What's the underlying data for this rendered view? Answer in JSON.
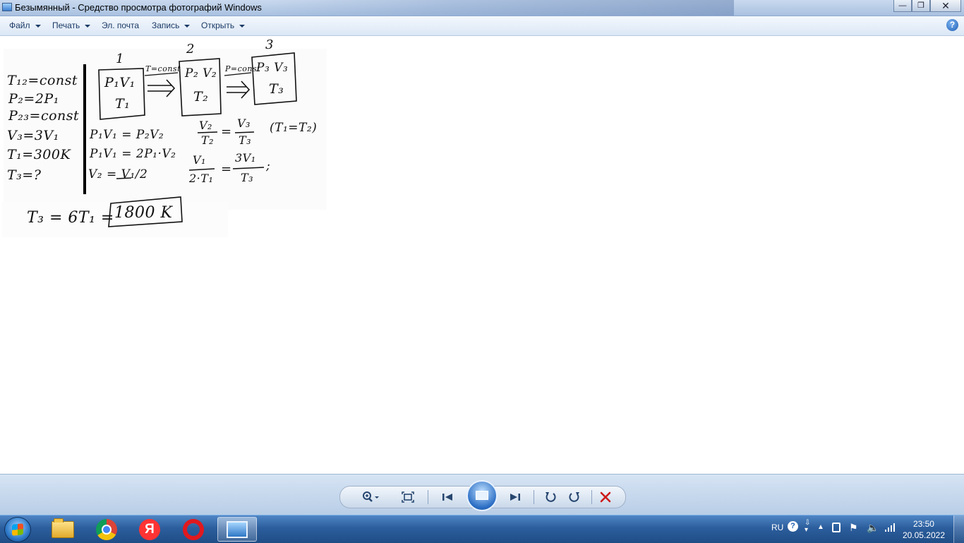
{
  "window": {
    "title": "Безымянный - Средство просмотра фотографий Windows",
    "buttons": [
      "minimize-button",
      "maximize-button",
      "close-button"
    ]
  },
  "menu": {
    "items": [
      {
        "label": "Файл",
        "has_dropdown": true
      },
      {
        "label": "Печать",
        "has_dropdown": true
      },
      {
        "label": "Эл. почта",
        "has_dropdown": false
      },
      {
        "label": "Запись",
        "has_dropdown": true
      },
      {
        "label": "Открыть",
        "has_dropdown": true
      }
    ],
    "help": "?"
  },
  "photo": {
    "given": [
      "T₁₂=const",
      "P₂=2P₁",
      "P₂₃=const",
      "V₃=3V₁",
      "T₁=300K",
      "T₃=?"
    ],
    "state_labels": [
      "1",
      "2",
      "3"
    ],
    "states": [
      {
        "top": "P₁V₁",
        "bottom": "T₁"
      },
      {
        "top": "P₂ V₂",
        "bottom": "T₂"
      },
      {
        "top": "P₃ V₃",
        "bottom": "T₃"
      }
    ],
    "transitions": [
      "T=const",
      "P=const"
    ],
    "equations_left": [
      "P₁V₁ = P₂V₂",
      "P₁V₁ = 2P₁·V₂",
      "V₂ = V₁/2"
    ],
    "eq_right_1": {
      "num_a": "V₂",
      "den_a": "T₂",
      "num_b": "V₃",
      "den_b": "T₃",
      "note": "(T₁=T₂)"
    },
    "eq_right_2": {
      "num_a": "V₁",
      "den_a": "2·T₁",
      "num_b": "3V₁",
      "den_b": "T₃",
      "tail": ";"
    },
    "result_prefix": "T₃ = 6T₁ =",
    "result_value": "1800 K"
  },
  "controls": {
    "icons": [
      "zoom-icon",
      "fit-icon",
      "previous-icon",
      "slideshow-icon",
      "next-icon",
      "rotate-left-icon",
      "rotate-right-icon",
      "delete-icon"
    ]
  },
  "taskbar": {
    "apps": [
      "explorer",
      "chrome",
      "yandex-browser",
      "opera",
      "photo-viewer"
    ],
    "yandex_letter": "Я",
    "language": "RU",
    "time": "23:50",
    "date": "20.05.2022"
  },
  "colors": {
    "delete": "#cc1b1b",
    "taskbar": "#2c5e9d"
  }
}
